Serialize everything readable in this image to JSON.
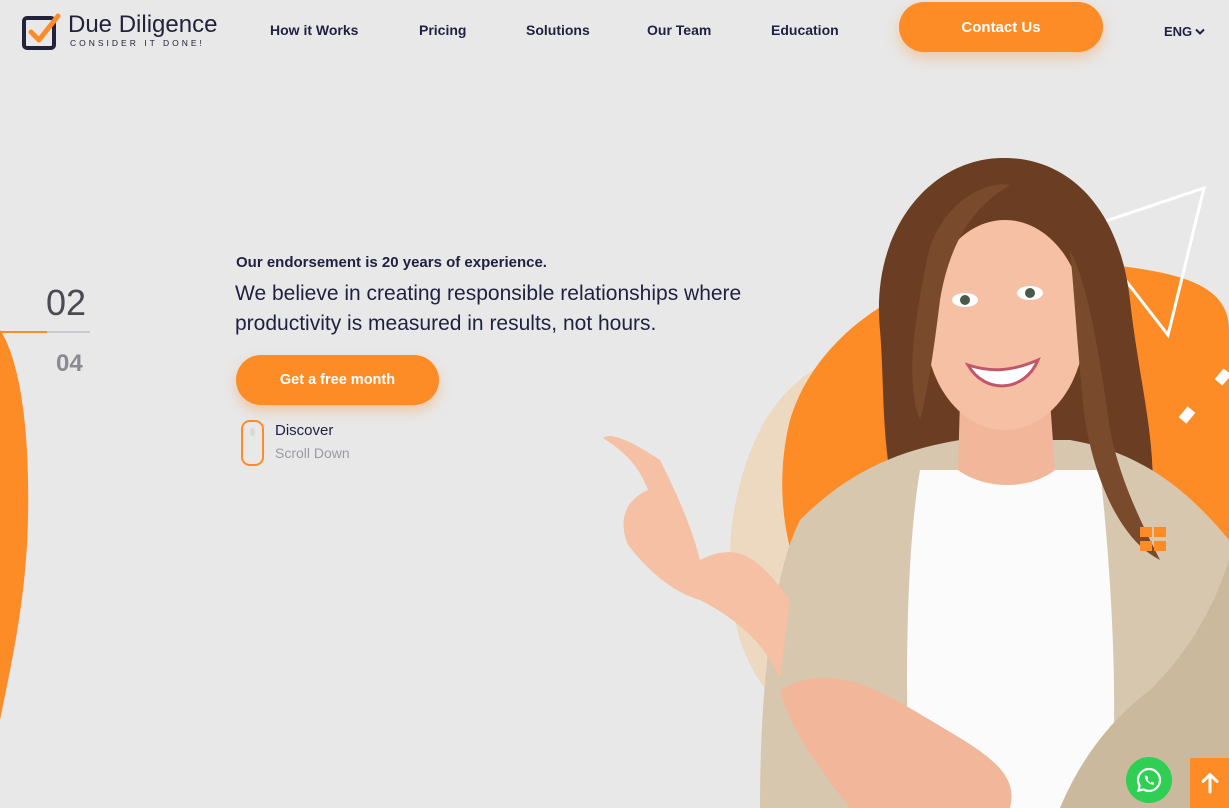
{
  "brand": {
    "name": "Due Diligence",
    "tagline": "CONSIDER IT DONE!",
    "accent_color": "#fd8c27",
    "text_color": "#1f2140"
  },
  "nav": {
    "items": [
      {
        "label": "How it Works"
      },
      {
        "label": "Pricing"
      },
      {
        "label": "Solutions"
      },
      {
        "label": "Our Team"
      },
      {
        "label": "Education"
      }
    ],
    "contact_label": "Contact Us",
    "language": "ENG",
    "language_icon": "chevron-down-icon"
  },
  "slider": {
    "current": "02",
    "next": "04",
    "progress": 0.52
  },
  "hero": {
    "subtitle": "Our endorsement is 20 years of experience.",
    "title": "We believe in creating responsible relationships where productivity is measured in results, not hours.",
    "cta_label": "Get a free month",
    "discover_title": "Discover",
    "discover_subtitle": "Scroll Down",
    "image_subject": "smiling woman pointing left"
  },
  "floating": {
    "whatsapp_icon": "whatsapp-icon",
    "whatsapp_color": "#2fcf53",
    "back_to_top_icon": "arrow-up-icon"
  }
}
